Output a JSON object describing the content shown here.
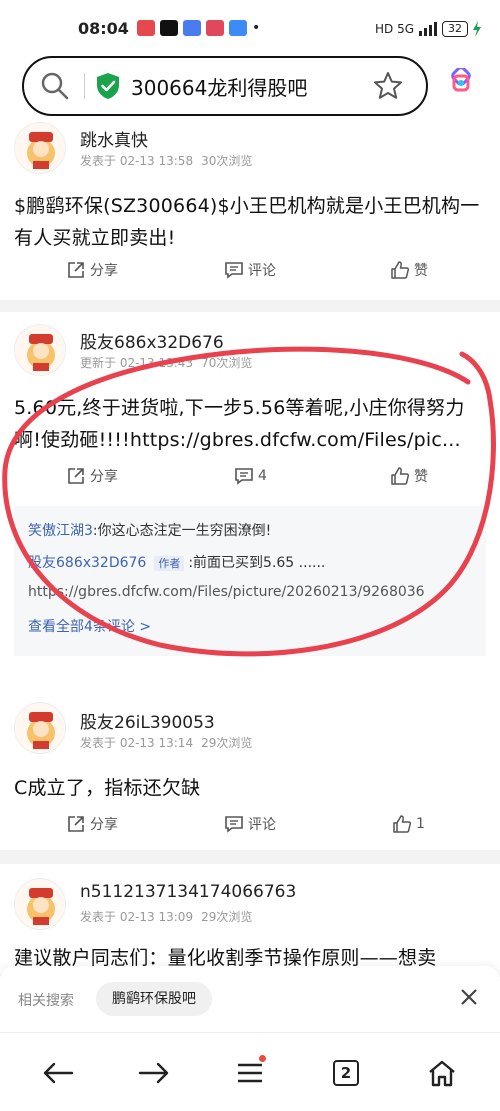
{
  "status_bar": {
    "time": "08:04",
    "network": "HD 5G",
    "battery": "32"
  },
  "search": {
    "query": "300664龙利得股吧"
  },
  "posts": [
    {
      "username": "跳水真快",
      "date": "发表于 02-13 13:58",
      "views": "30次浏览",
      "content": "$鹏鹞环保(SZ300664)$小王巴机构就是小王巴机构一有人买就立即卖出!",
      "share": "分享",
      "comment": "评论",
      "like": "赞"
    },
    {
      "username": "股友686x32D676",
      "date": "更新于 02-13 13:43",
      "views": "70次浏览",
      "content": "5.60元,终于进货啦,下一步5.56等着呢,小庄你得努力啊!使劲砸!!!!https://gbres.dfcfw.com/Files/pic...",
      "share": "分享",
      "comment": "4",
      "like": "赞",
      "replies": [
        {
          "user": "笑傲江湖3",
          "text": ":你这心态注定一生穷困潦倒!"
        },
        {
          "user": "股友686x32D676",
          "tag": "作者",
          "text": ":前面已买到5.65 ......"
        },
        {
          "text": "https://gbres.dfcfw.com/Files/picture/20260213/9268036"
        }
      ],
      "view_all": "查看全部4条评论 >"
    },
    {
      "username": "股友26iL390053",
      "date": "发表于 02-13 13:14",
      "views": "29次浏览",
      "content": "C成立了，指标还欠缺",
      "share": "分享",
      "comment": "评论",
      "like": "1"
    },
    {
      "username": "n5112137134174066763",
      "date": "发表于 02-13 13:09",
      "views": "29次浏览",
      "content": "建议散户同志们：量化收割季节操作原则——想卖"
    }
  ],
  "related": {
    "label": "相关搜索",
    "chip": "鹏鹞环保股吧"
  },
  "nav": {
    "tabs": "2"
  },
  "colors": {
    "accent": "#3e64b0",
    "annotation": "#e8424f",
    "shield": "#1aa34a"
  }
}
